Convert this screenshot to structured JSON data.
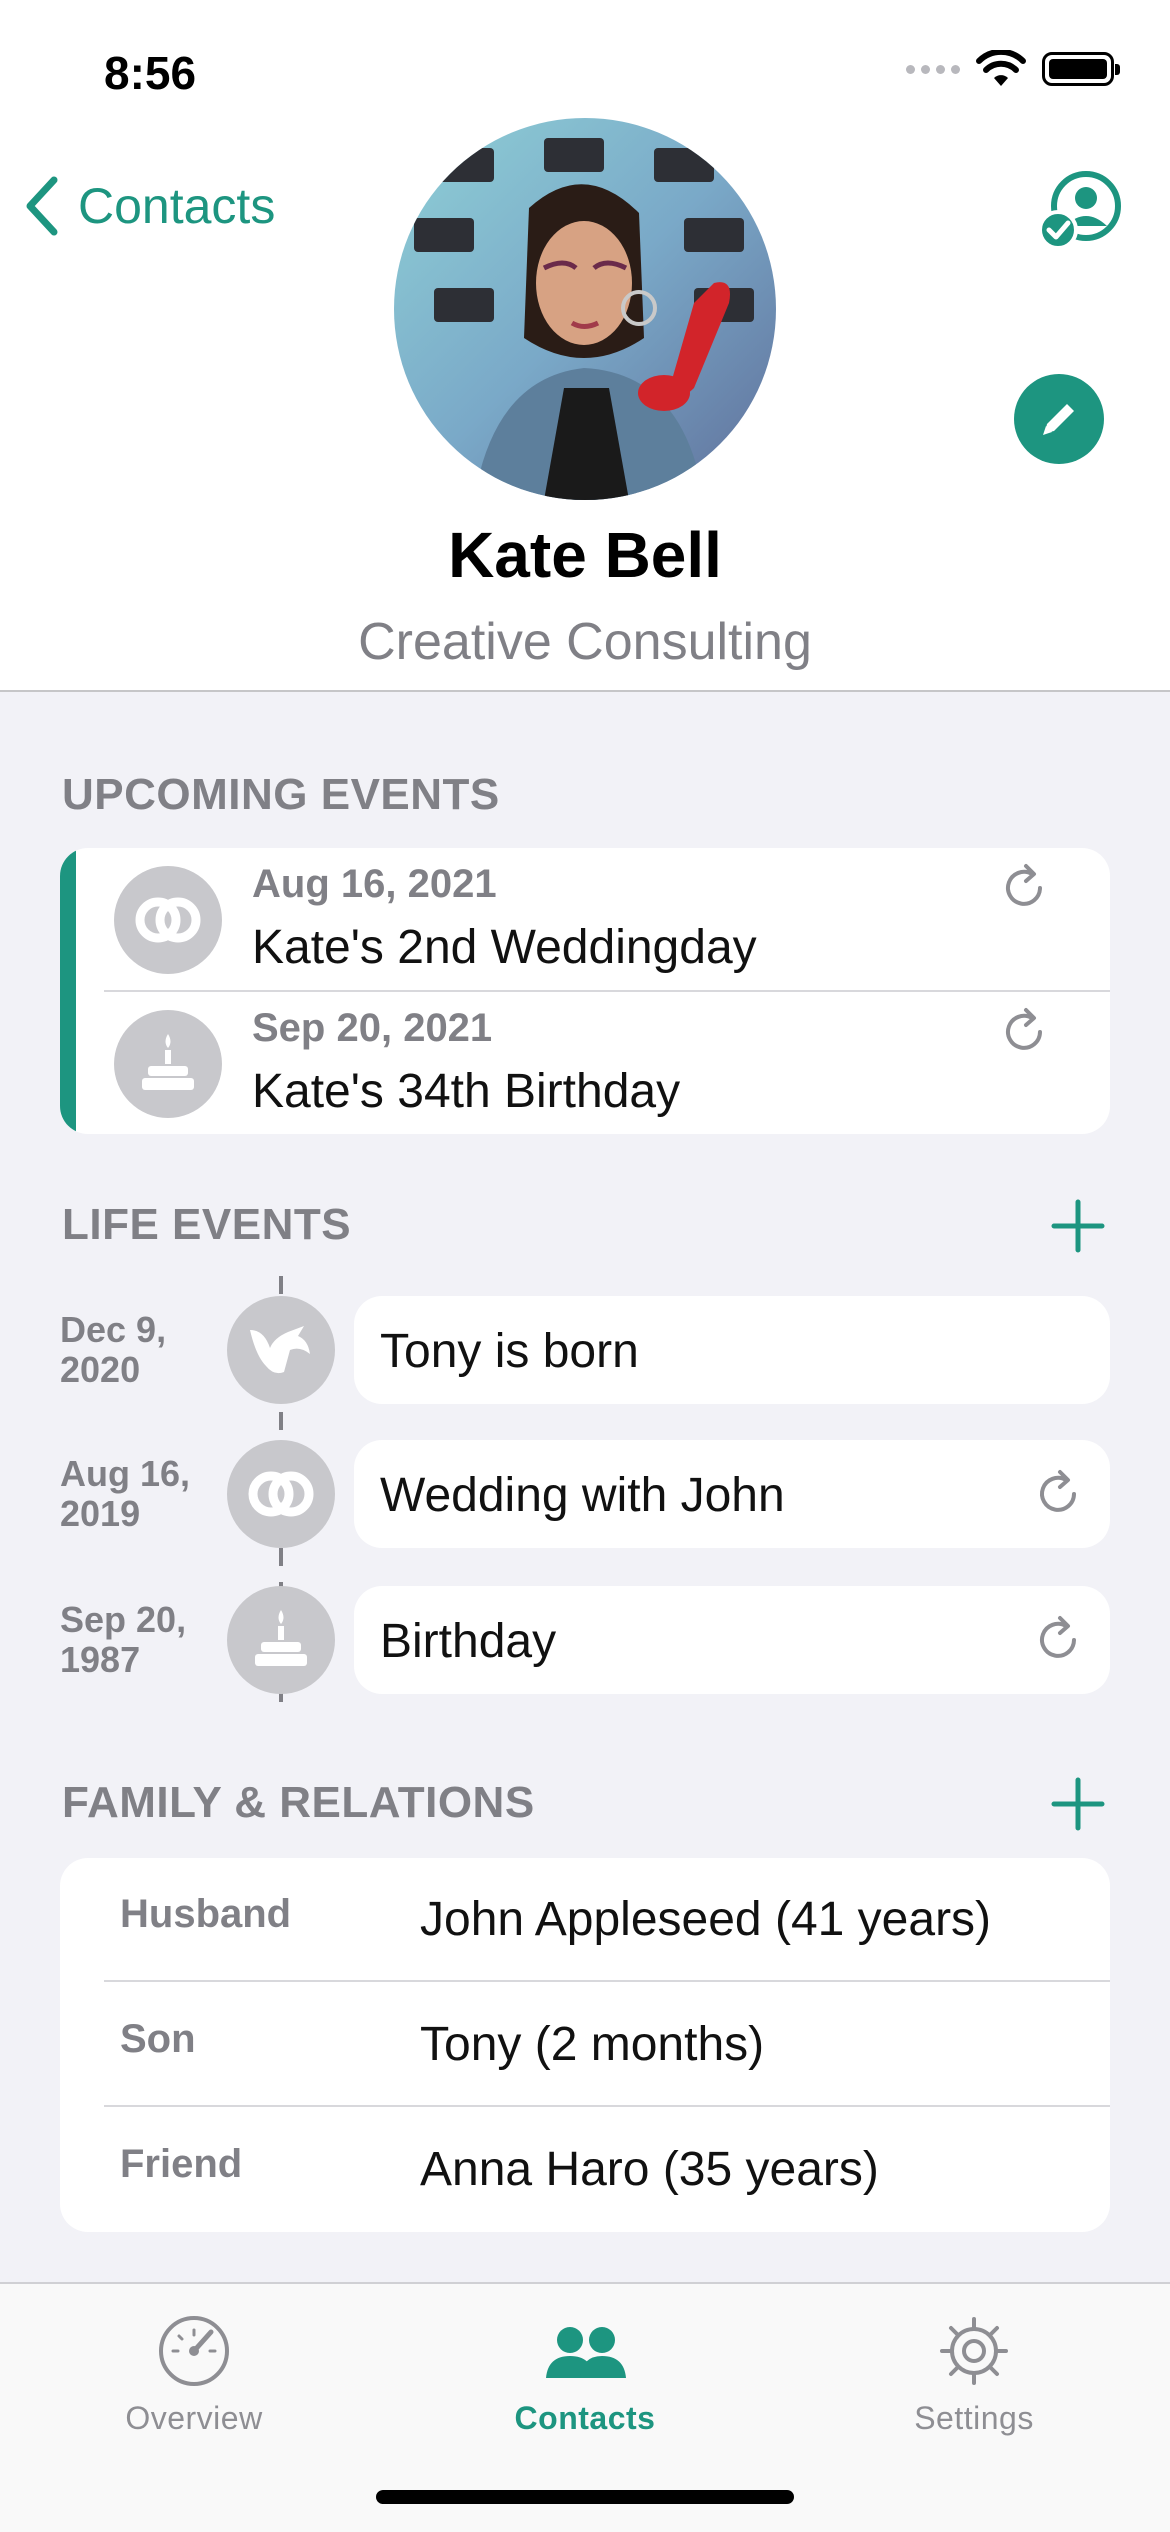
{
  "status_bar": {
    "time": "8:56"
  },
  "nav": {
    "back_label": "Contacts"
  },
  "contact": {
    "name": "Kate Bell",
    "company": "Creative Consulting"
  },
  "upcoming": {
    "title": "UPCOMING EVENTS",
    "events": [
      {
        "date": "Aug 16, 2021",
        "title": "Kate's 2nd Weddingday",
        "icon": "rings-icon"
      },
      {
        "date": "Sep 20, 2021",
        "title": "Kate's 34th Birthday",
        "icon": "birthday-cake-icon"
      }
    ]
  },
  "life_events": {
    "title": "LIFE EVENTS",
    "events": [
      {
        "date_line1": "Dec 9,",
        "date_line2": "2020",
        "title": "Tony is born",
        "icon": "stork-icon",
        "repeating": false
      },
      {
        "date_line1": "Aug 16,",
        "date_line2": "2019",
        "title": "Wedding with John",
        "icon": "rings-icon",
        "repeating": true
      },
      {
        "date_line1": "Sep 20,",
        "date_line2": "1987",
        "title": "Birthday",
        "icon": "birthday-cake-icon",
        "repeating": true
      }
    ]
  },
  "relations": {
    "title": "FAMILY & RELATIONS",
    "items": [
      {
        "type": "Husband",
        "name": "John Appleseed (41 years)"
      },
      {
        "type": "Son",
        "name": "Tony (2 months)"
      },
      {
        "type": "Friend",
        "name": "Anna Haro (35 years)"
      }
    ]
  },
  "tabs": [
    {
      "label": "Overview",
      "icon": "speedometer-icon",
      "active": false
    },
    {
      "label": "Contacts",
      "icon": "people-icon",
      "active": true
    },
    {
      "label": "Settings",
      "icon": "gear-icon",
      "active": false
    }
  ],
  "colors": {
    "accent": "#1d9580",
    "secondary_text": "#808086",
    "background": "#f2f2f7",
    "icon_circle": "#c8c8cc"
  }
}
